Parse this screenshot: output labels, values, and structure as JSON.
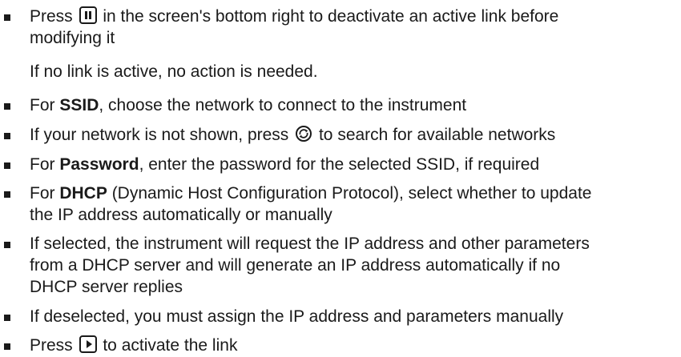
{
  "items": [
    {
      "pre": "Press ",
      "icon": "pause-icon",
      "post": " in the screen's bottom right to deactivate an active link before",
      "line2": "modifying it"
    },
    {
      "text": "If no link is active, no action is needed."
    },
    {
      "pre": "For ",
      "bold": "SSID",
      "post": ", choose the network to connect to the instrument"
    },
    {
      "pre": "If your network is not shown, press ",
      "icon": "refresh-icon",
      "post": " to search for available networks"
    },
    {
      "pre": "For ",
      "bold": "Password",
      "post": ", enter the password for the selected SSID, if required"
    },
    {
      "pre": "For ",
      "bold": "DHCP",
      "post": " (Dynamic Host Configuration Protocol), select whether to update",
      "line2": "the IP address automatically or manually"
    },
    {
      "line1": "If selected, the instrument will request the IP address and other parameters",
      "line2": "from a DHCP server and will generate an IP address automatically if no",
      "line3": "DHCP server replies"
    },
    {
      "text": "If deselected, you must assign the IP address and parameters manually"
    },
    {
      "pre": "Press ",
      "icon": "play-icon",
      "post": " to activate the link"
    }
  ]
}
